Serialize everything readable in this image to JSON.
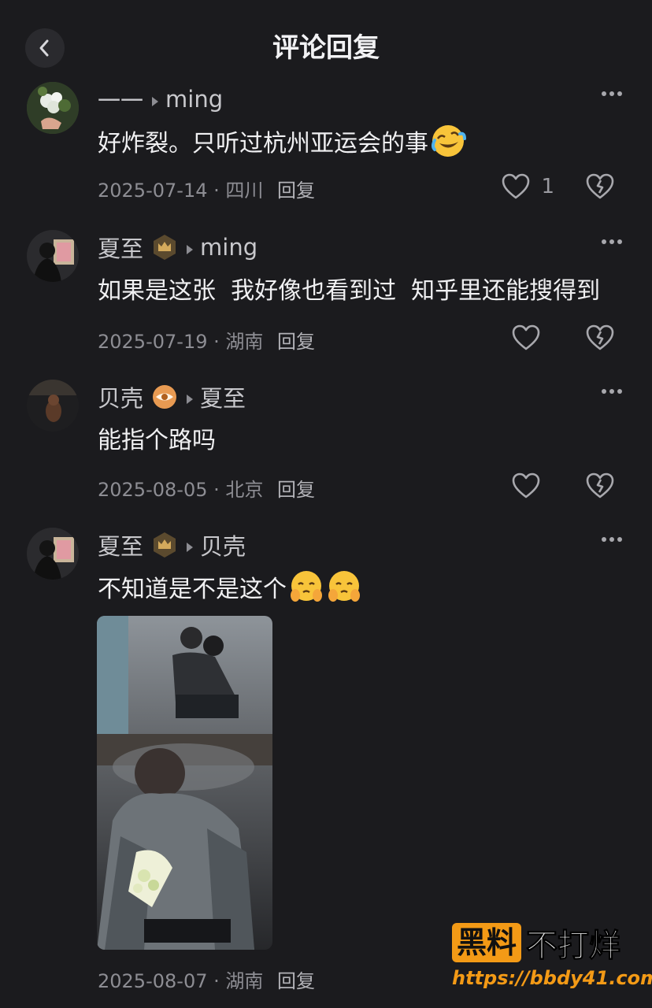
{
  "header": {
    "title": "评论回复"
  },
  "comments": [
    {
      "author": "一一",
      "reply_to": "ming",
      "text": "好炸裂。只听过杭州亚运会的事",
      "date": "2025-07-14",
      "location": "四川",
      "reply_label": "回复",
      "likes": "1",
      "badge": "",
      "emoji": [
        "crying-laughing-emoji"
      ]
    },
    {
      "author": "夏至",
      "reply_to": "ming",
      "text": "如果是这张  我好像也看到过  知乎里还能搜得到",
      "date": "2025-07-19",
      "location": "湖南",
      "reply_label": "回复",
      "likes": "",
      "badge": "crown-badge-icon",
      "emoji": []
    },
    {
      "author": "贝壳",
      "reply_to": "夏至",
      "text": "能指个路吗",
      "date": "2025-08-05",
      "location": "北京",
      "reply_label": "回复",
      "likes": "",
      "badge": "eye-badge-icon",
      "emoji": []
    },
    {
      "author": "夏至",
      "reply_to": "贝壳",
      "text": "不知道是不是这个",
      "date": "2025-08-07",
      "location": "湖南",
      "reply_label": "回复",
      "likes": "",
      "badge": "crown-badge-icon",
      "emoji": [
        "shy-face-emoji",
        "shy-face-emoji"
      ]
    }
  ],
  "watermark": {
    "line1_a": "黑料",
    "line1_b": "不打烊",
    "line2": "https://bbdy41.com"
  },
  "colors": {
    "background": "#1b1b1e",
    "watermark_orange": "#f39a16"
  }
}
